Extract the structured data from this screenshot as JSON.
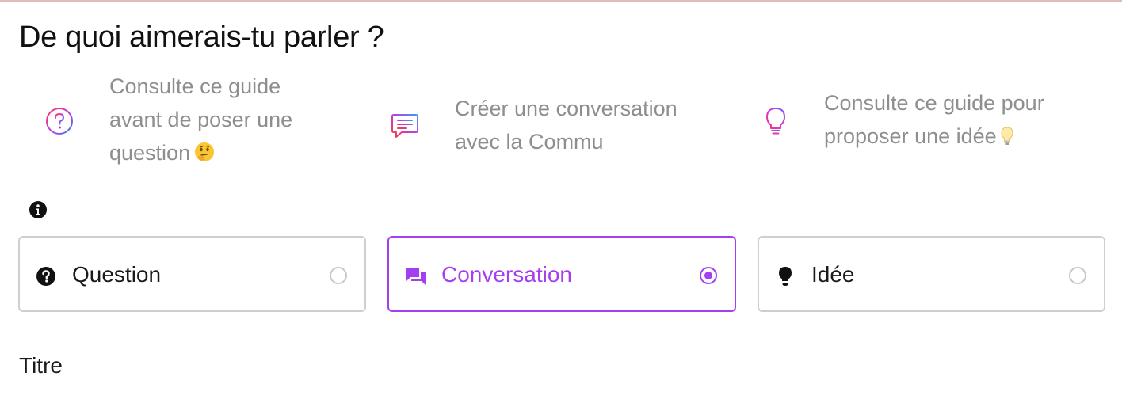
{
  "header": {
    "title": "De quoi aimerais-tu parler ?"
  },
  "guides": [
    {
      "icon": "question-circle-icon",
      "lines": [
        "Consulte ce guide",
        "avant de poser une",
        "question"
      ],
      "emoji": "thinking-face-icon"
    },
    {
      "icon": "chat-bubble-icon",
      "lines": [
        "Créer une conversation",
        "avec la Commu"
      ]
    },
    {
      "icon": "lightbulb-icon",
      "lines": [
        "Consulte ce guide pour",
        "proposer une idée"
      ],
      "emoji": "lightbulb-emoji-icon"
    }
  ],
  "info": {
    "icon": "info-icon"
  },
  "post_types": [
    {
      "icon": "question-icon",
      "label": "Question",
      "selected": false
    },
    {
      "icon": "forum-icon",
      "label": "Conversation",
      "selected": true
    },
    {
      "icon": "lightbulb-icon",
      "label": "Idée",
      "selected": false
    }
  ],
  "form": {
    "title_label": "Titre"
  },
  "colors": {
    "accent": "#a43ff1",
    "muted_text": "#8e8e8e",
    "border": "#cfcfcf"
  }
}
